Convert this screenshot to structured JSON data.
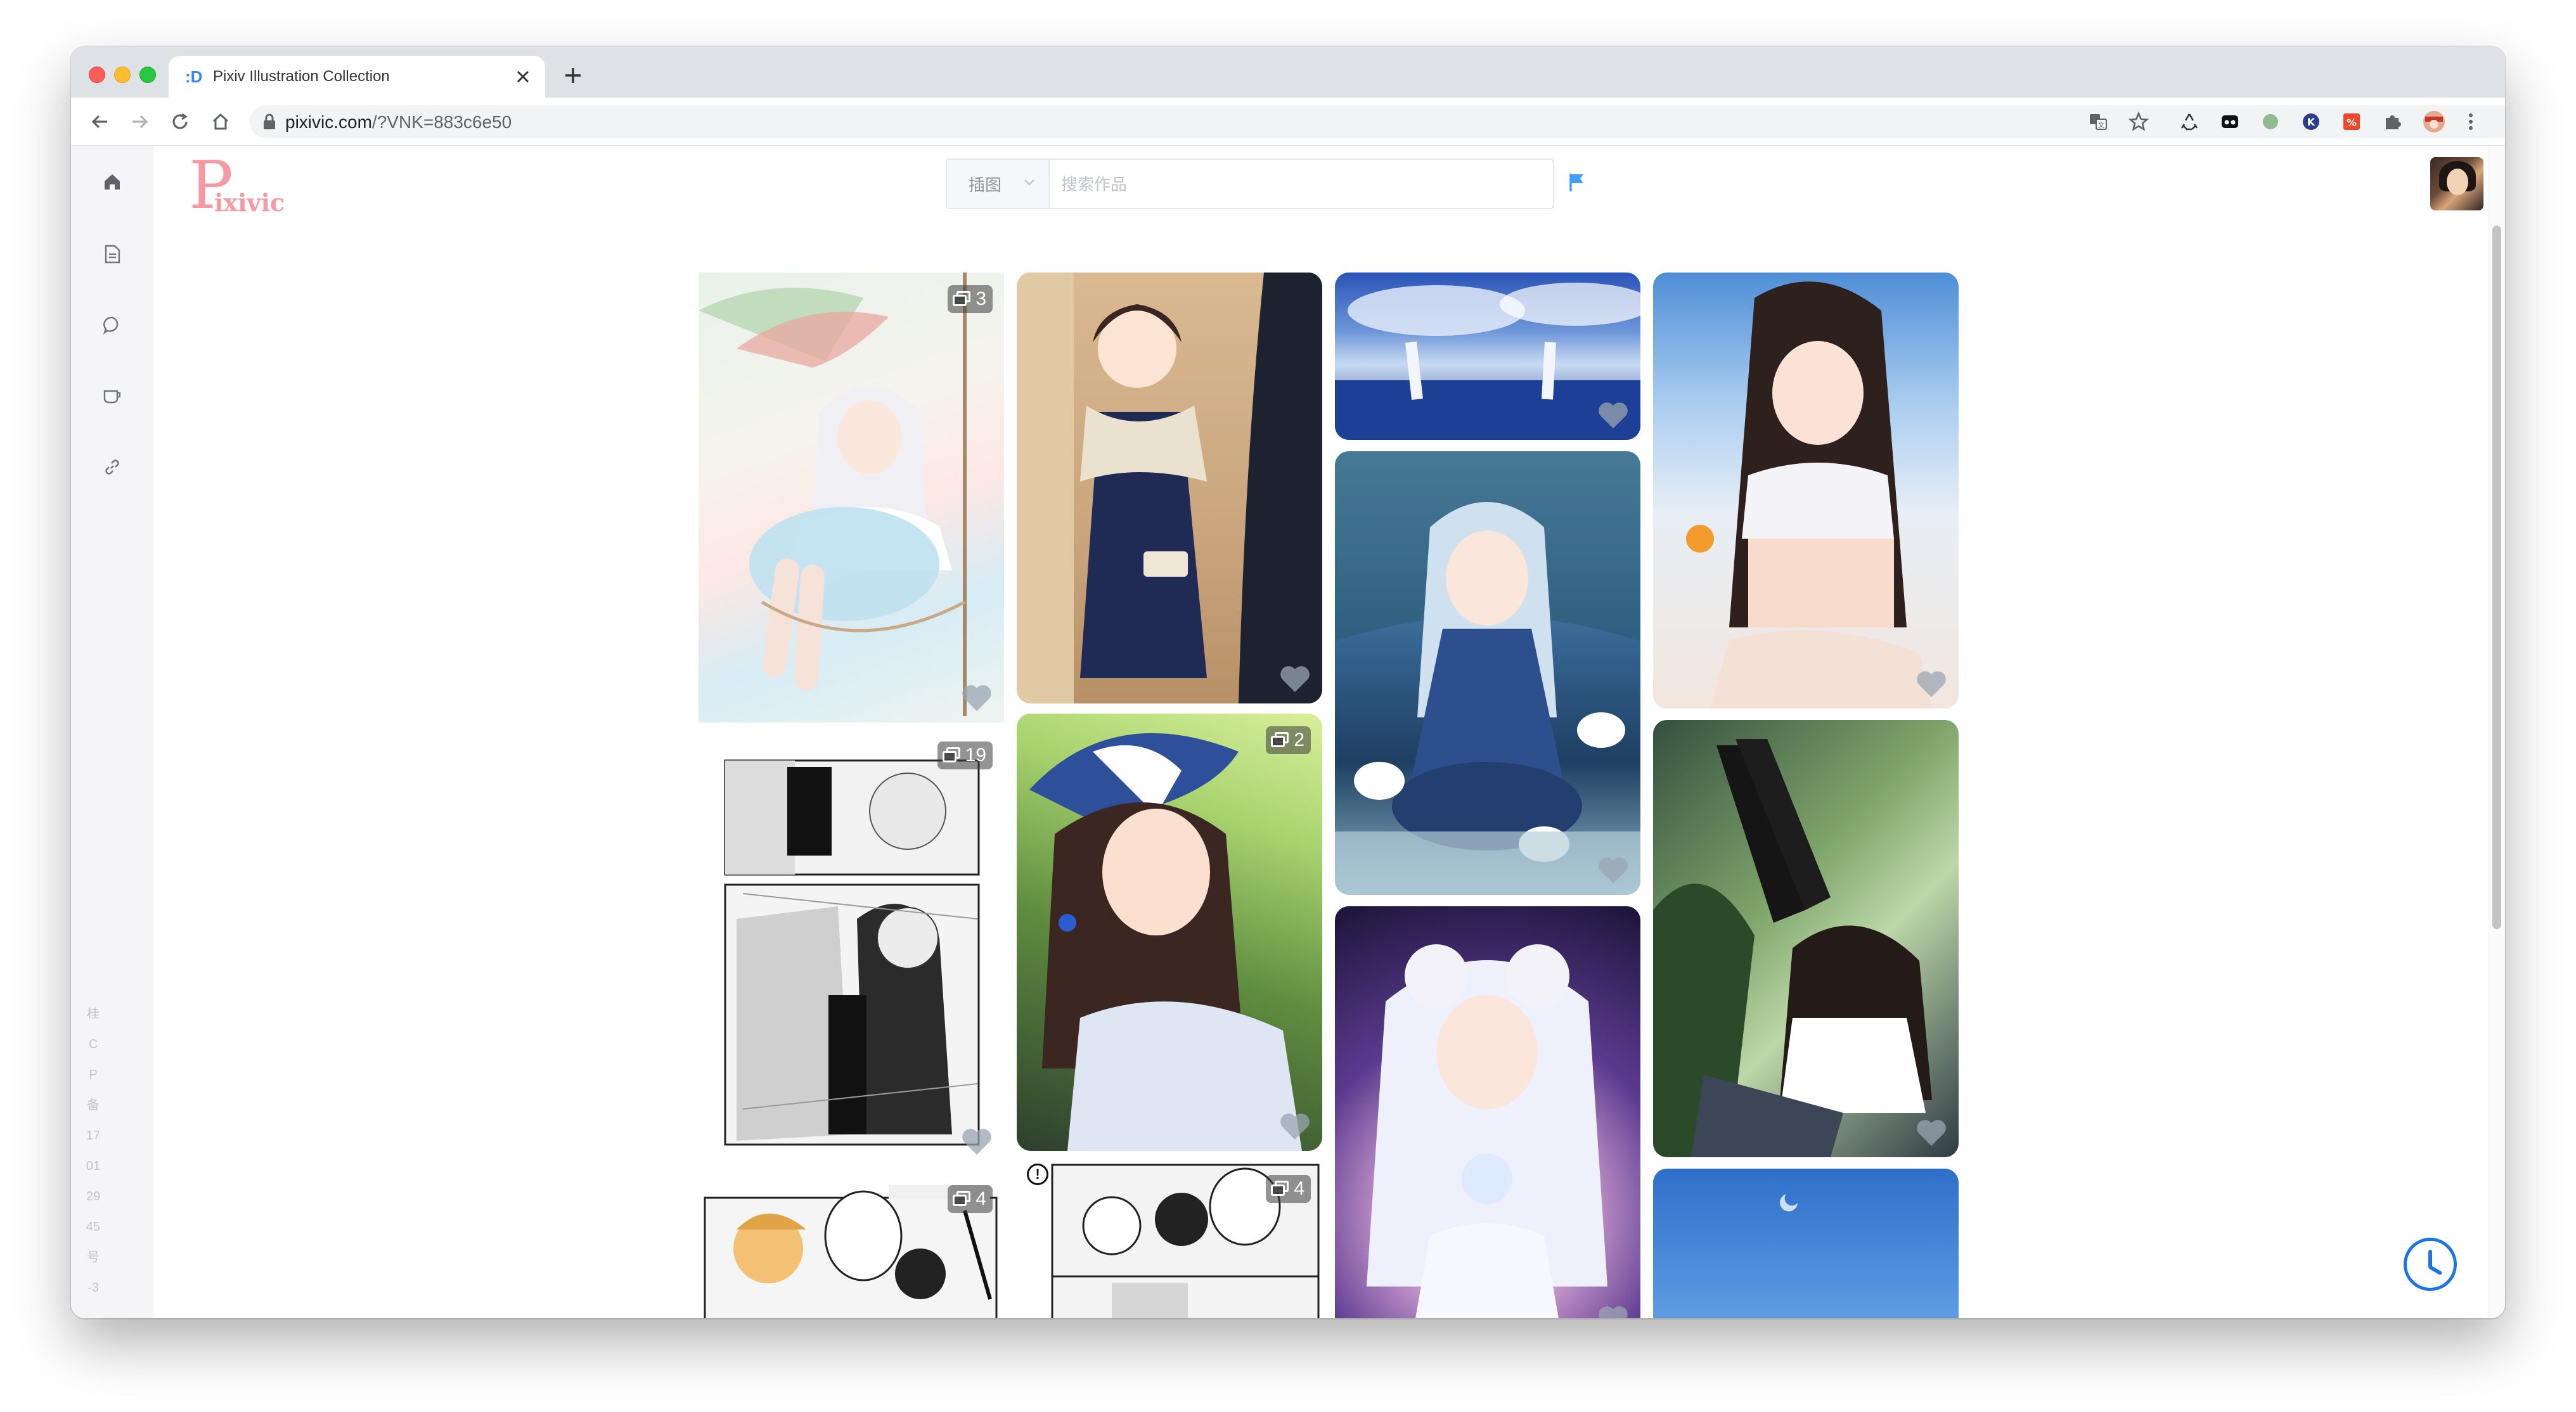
{
  "browser": {
    "tab_favicon": ":D",
    "tab_title": "Pixiv Illustration Collection",
    "url_host": "pixivic.com",
    "url_path": "/?VNK=883c6e50"
  },
  "header": {
    "logo_letter": "P",
    "logo_text": "ixivic",
    "search_type_label": "插图",
    "search_placeholder": "搜索作品"
  },
  "sidebar": {
    "items": [
      {
        "icon": "home-icon"
      },
      {
        "icon": "document-icon"
      },
      {
        "icon": "chat-icon"
      },
      {
        "icon": "coffee-icon"
      },
      {
        "icon": "link-icon"
      }
    ],
    "footer_lines": [
      "桂",
      "C",
      "P",
      "备",
      "17",
      "01",
      "29",
      "45",
      "号",
      "-3"
    ]
  },
  "gallery": {
    "cards": [
      {
        "badge": "3"
      },
      {
        "badge": "19"
      },
      {
        "badge": "4"
      },
      {
        "badge": ""
      },
      {
        "badge": "2"
      },
      {
        "badge": "4"
      }
    ]
  },
  "colors": {
    "accent": "#1a73e8",
    "logo": "#f59aa2",
    "flag": "#409eff"
  }
}
